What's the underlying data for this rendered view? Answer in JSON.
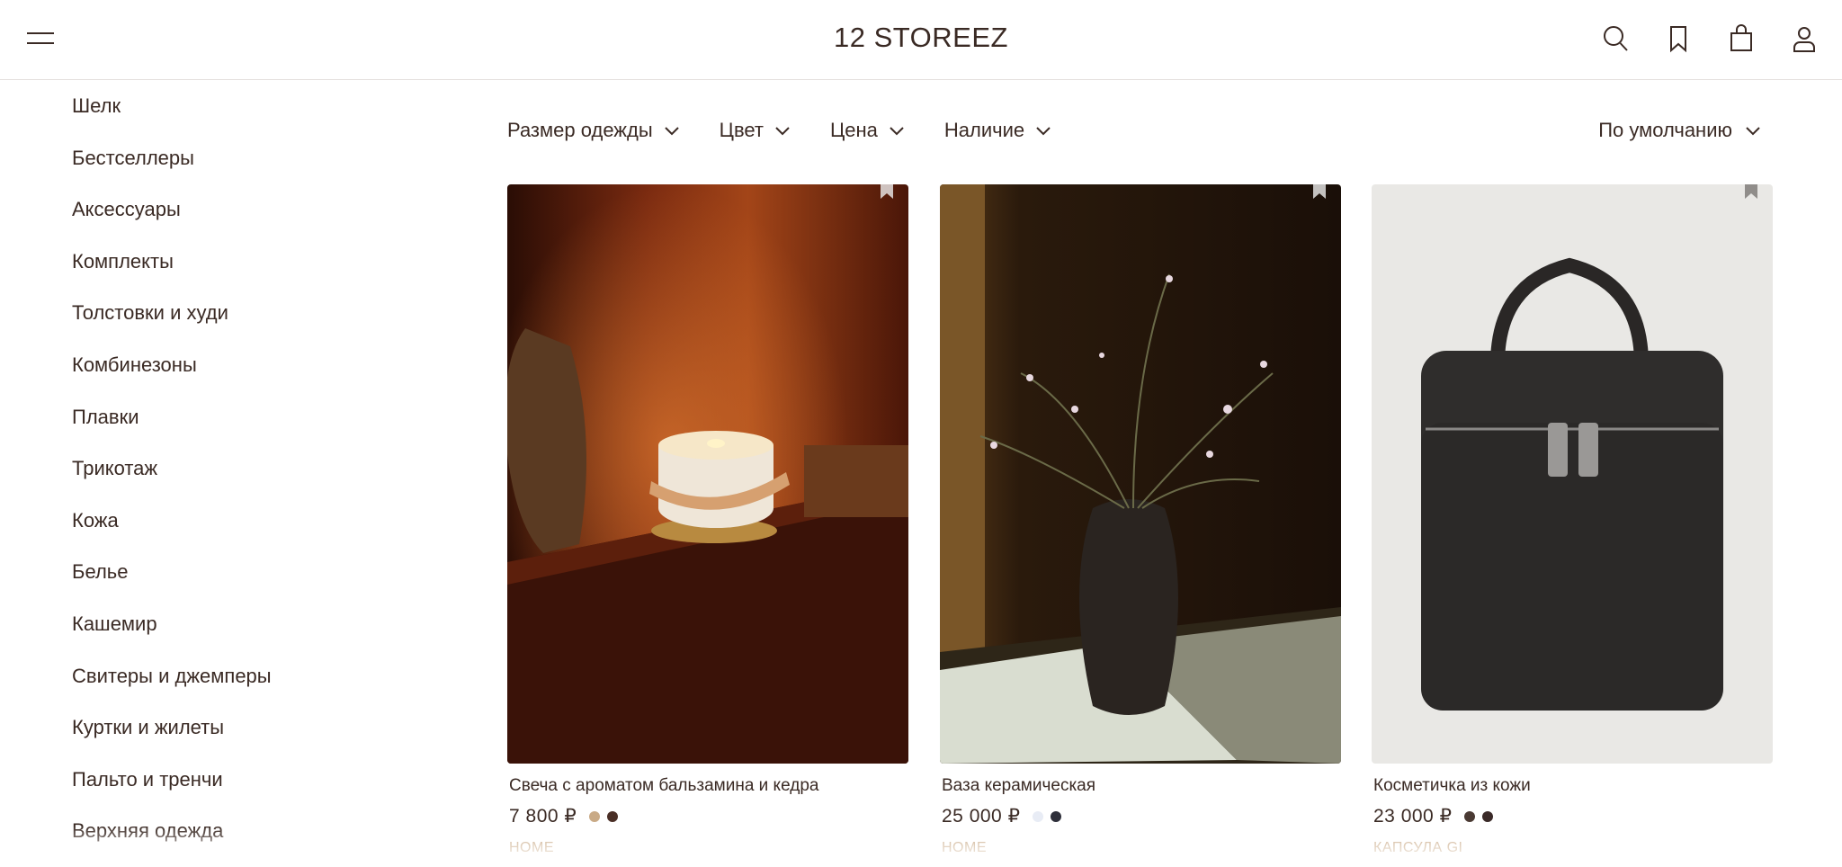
{
  "header": {
    "logo": "12 STOREEZ",
    "icons": [
      "menu-icon",
      "search-icon",
      "bookmark-icon",
      "bag-icon",
      "user-icon"
    ]
  },
  "sidebar": {
    "items": [
      "Шелк",
      "Бестселлеры",
      "Аксессуары",
      "Комплекты",
      "Толстовки и худи",
      "Комбинезоны",
      "Плавки",
      "Трикотаж",
      "Кожа",
      "Белье",
      "Кашемир",
      "Свитеры и джемперы",
      "Куртки и жилеты",
      "Пальто и тренчи",
      "Верхняя одежда"
    ]
  },
  "filters": {
    "size": "Размер одежды",
    "color": "Цвет",
    "price": "Цена",
    "availability": "Наличие",
    "sort": "По умолчанию"
  },
  "products": [
    {
      "name": "Свеча с ароматом бальзамина и кедра",
      "price": "7 800 ₽",
      "tag": "HOME",
      "swatches": [
        "#c9aa86",
        "#4a2f26"
      ]
    },
    {
      "name": "Ваза керамическая",
      "price": "25 000 ₽",
      "tag": "HOME",
      "swatches": [
        "#e8ecf5",
        "#2e2f3a"
      ]
    },
    {
      "name": "Косметичка из кожи",
      "price": "23 000 ₽",
      "tag": "КАПСУЛА GI",
      "swatches": [
        "#4a3a33",
        "#3a2a28"
      ]
    }
  ],
  "colors": {
    "text": "#3a2a24",
    "tag": "#c4a27c",
    "divider": "#e4e0dd"
  }
}
